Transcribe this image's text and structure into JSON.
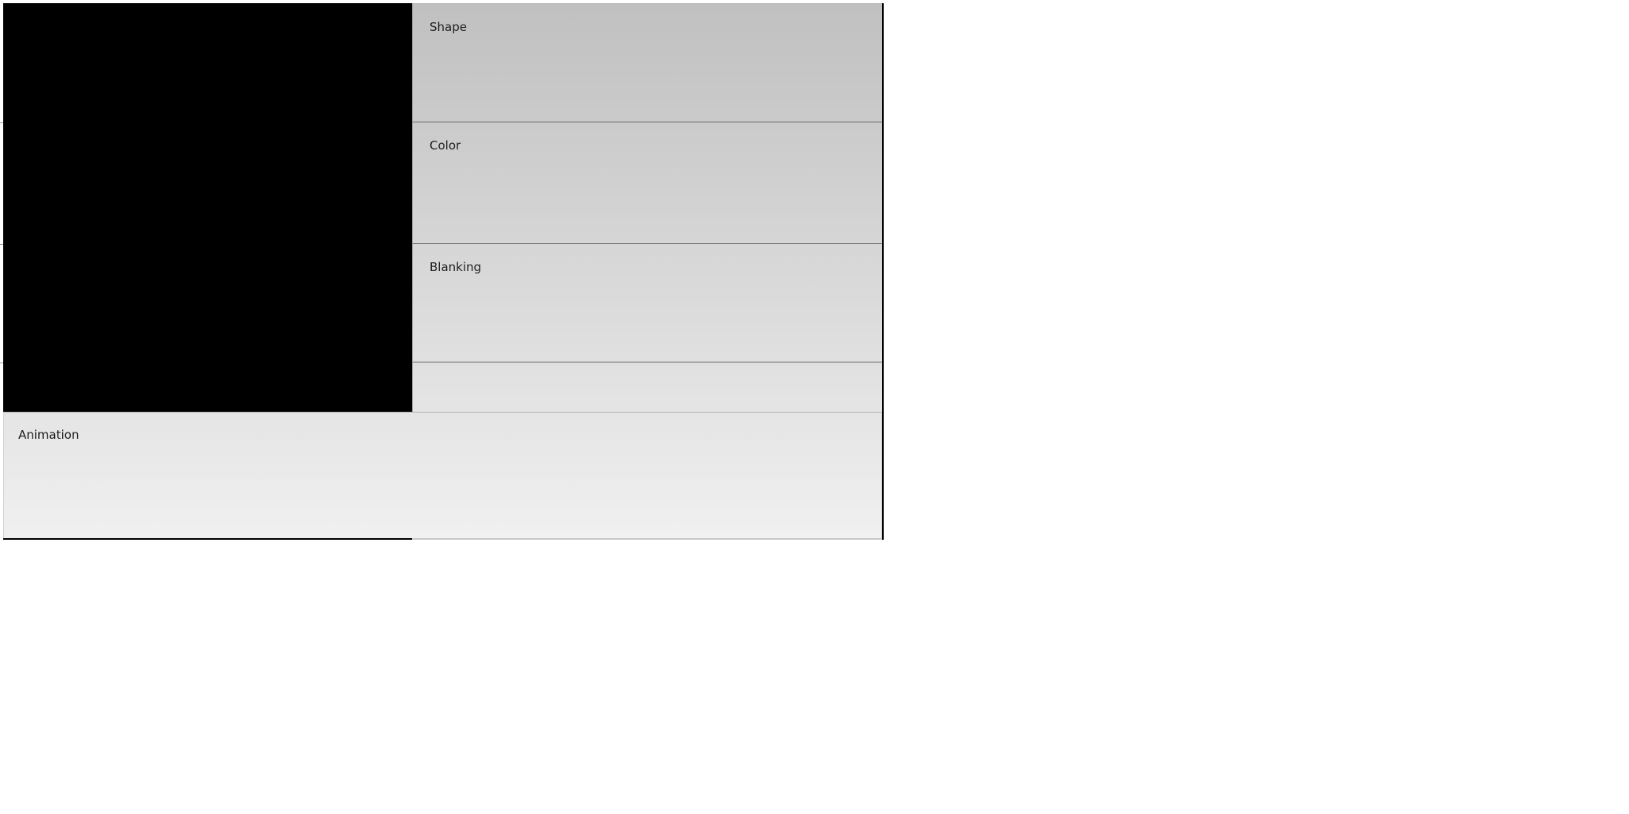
{
  "panels": {
    "shape": {
      "label": "Shape"
    },
    "color": {
      "label": "Color"
    },
    "blanking": {
      "label": "Blanking"
    },
    "animation": {
      "label": "Animation"
    }
  },
  "colors": {
    "preview_background": "#000000",
    "panel_gradient_top": "#c0c0c0",
    "panel_gradient_bottom": "#f0f0f0",
    "label_text": "#222222"
  }
}
